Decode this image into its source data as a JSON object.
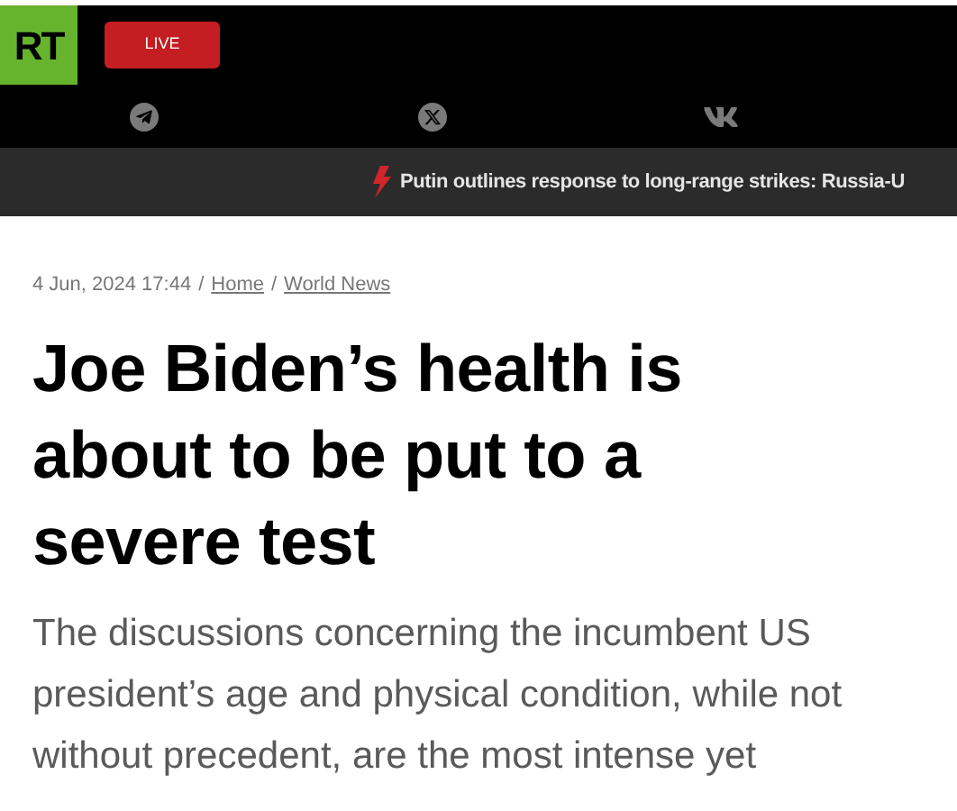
{
  "header": {
    "logo": "RT",
    "live_button": "LIVE"
  },
  "social_links": [
    {
      "kind": "telegram"
    },
    {
      "kind": "x"
    },
    {
      "kind": "vk"
    }
  ],
  "ticker": {
    "headline": "Putin outlines response to long-range strikes: Russia-U"
  },
  "article": {
    "date": "4 Jun, 2024 17:44",
    "breadcrumbs": [
      {
        "label": "Home"
      },
      {
        "label": "World News"
      }
    ],
    "separator": "/",
    "title": "Joe Biden’s health is about to be put to a severe test",
    "summary": "The discussions concerning the incumbent US president’s age and physical condition, while not without precedent, are the most intense yet"
  }
}
